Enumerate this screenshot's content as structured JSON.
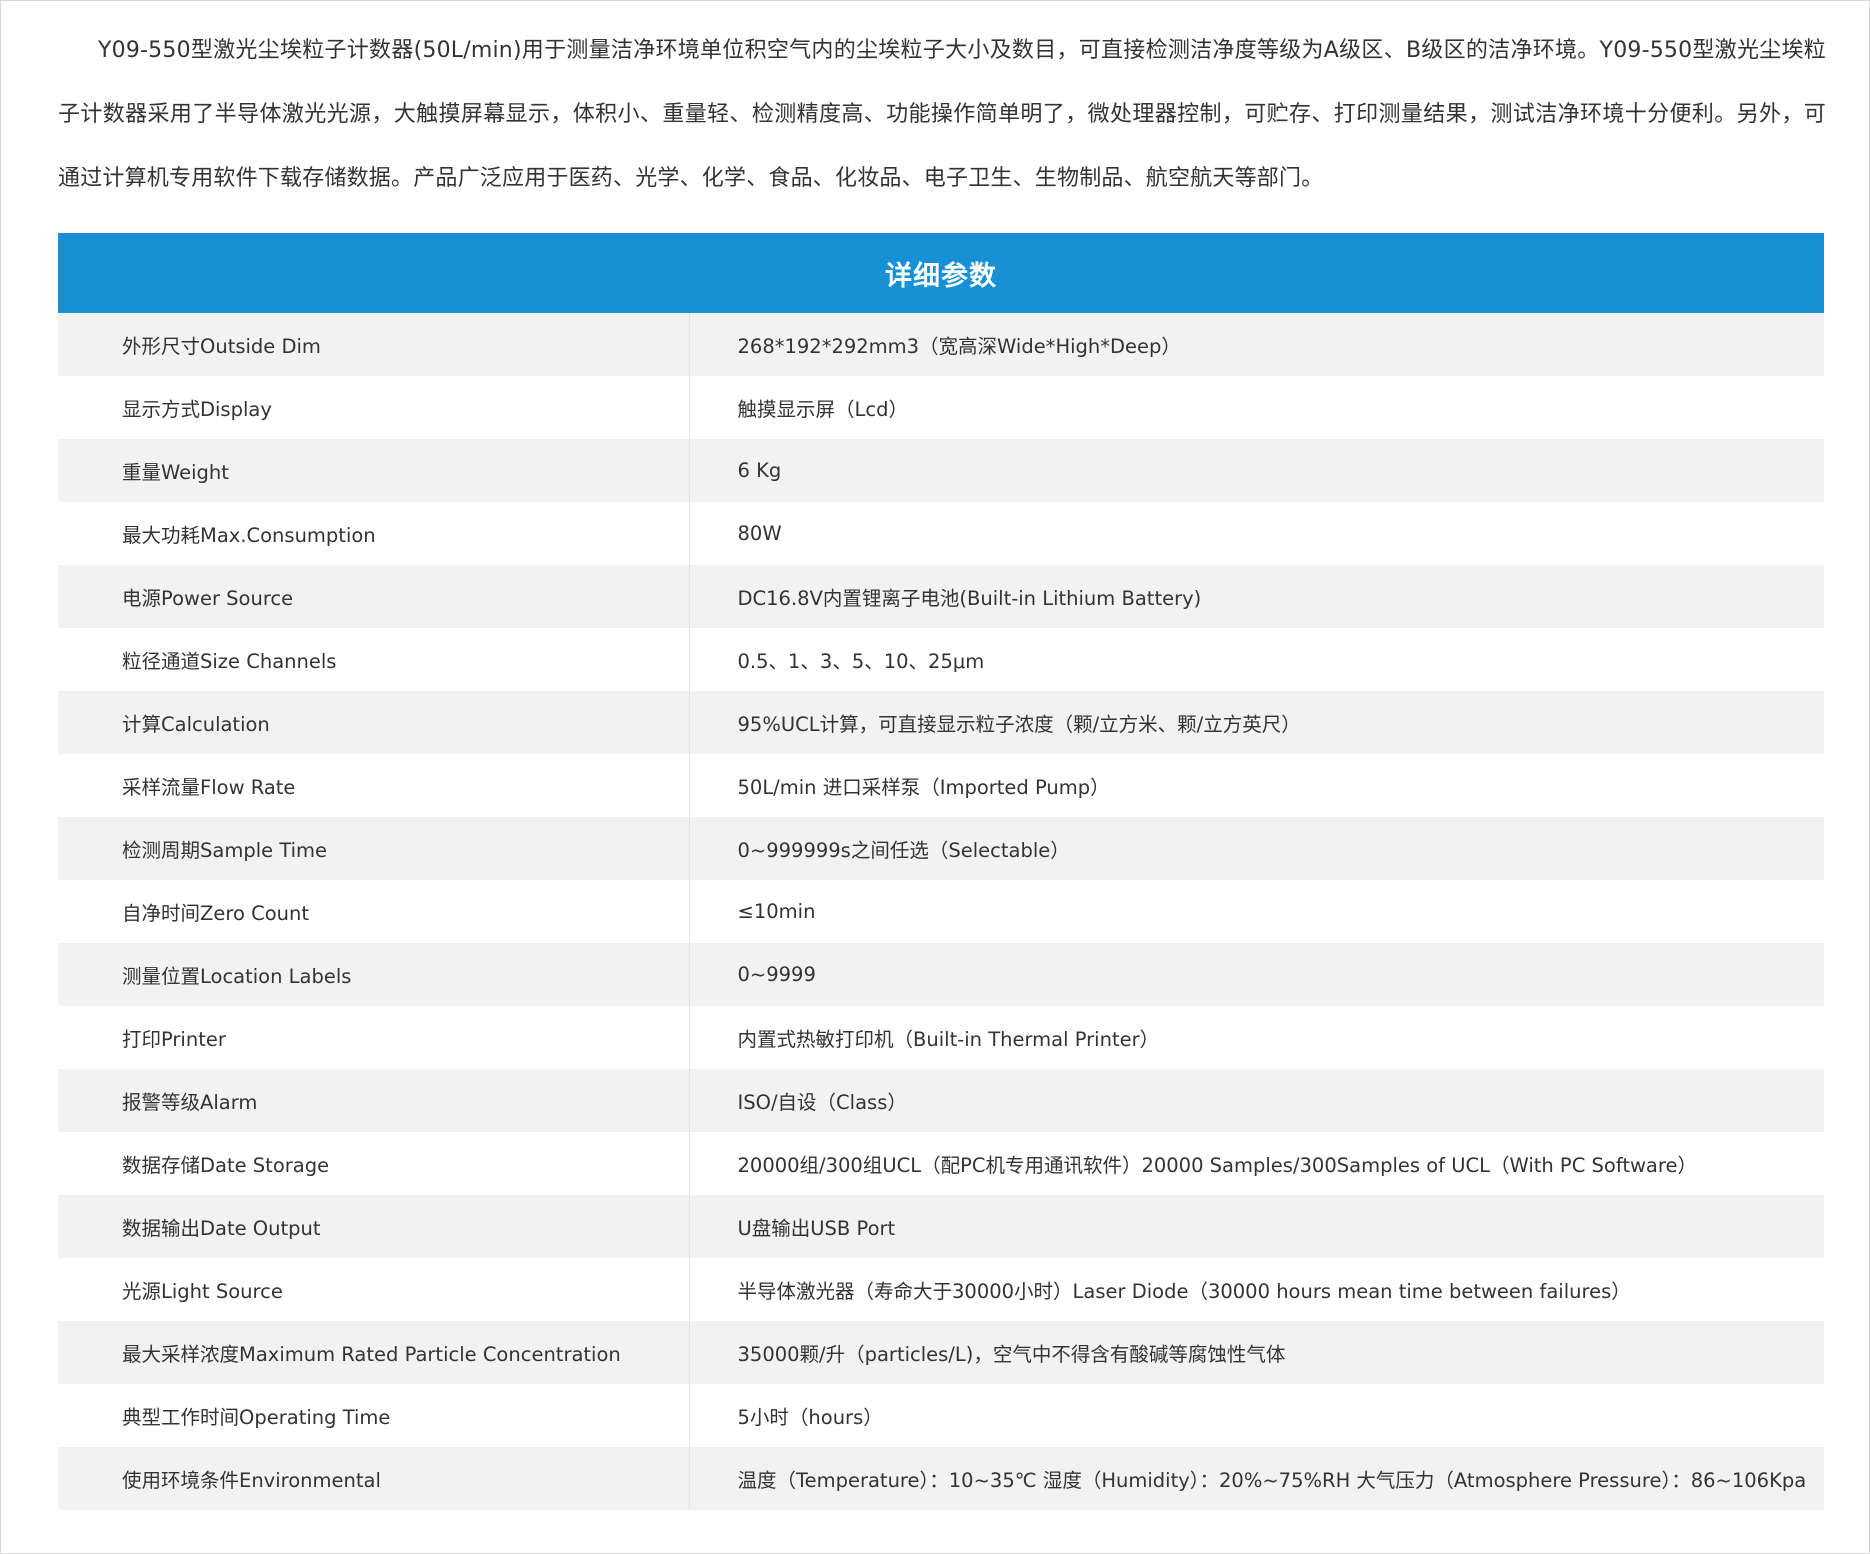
{
  "intro": "Y09-550型激光尘埃粒子计数器(50L/min)用于测量洁净环境单位积空气内的尘埃粒子大小及数目，可直接检测洁净度等级为A级区、B级区的洁净环境。Y09-550型激光尘埃粒子计数器采用了半导体激光光源，大触摸屏幕显示，体积小、重量轻、检测精度高、功能操作简单明了，微处理器控制，可贮存、打印测量结果，测试洁净环境十分便利。另外，可通过计算机专用软件下载存储数据。产品广泛应用于医药、光学、化学、食品、化妆品、电子卫生、生物制品、航空航天等部门。",
  "table": {
    "header": "详细参数",
    "rows": [
      {
        "k": "外形尺寸Outside Dim",
        "v": "268*192*292mm3（宽高深Wide*High*Deep）"
      },
      {
        "k": "显示方式Display",
        "v": "触摸显示屏（Lcd）"
      },
      {
        "k": "重量Weight",
        "v": "6 Kg"
      },
      {
        "k": "最大功耗Max.Consumption",
        "v": "80W"
      },
      {
        "k": "电源Power Source",
        "v": "DC16.8V内置锂离子电池(Built-in Lithium Battery)"
      },
      {
        "k": "粒径通道Size Channels",
        "v": "0.5、1、3、5、10、25μm"
      },
      {
        "k": "计算Calculation",
        "v": "95%UCL计算，可直接显示粒子浓度（颗/立方米、颗/立方英尺）"
      },
      {
        "k": "采样流量Flow Rate",
        "v": "50L/min 进口采样泵（Imported Pump）"
      },
      {
        "k": "检测周期Sample Time",
        "v": "0~999999s之间任选（Selectable）"
      },
      {
        "k": "自净时间Zero Count",
        "v": "≤10min"
      },
      {
        "k": "测量位置Location Labels",
        "v": "0~9999"
      },
      {
        "k": "打印Printer",
        "v": "内置式热敏打印机（Built-in Thermal Printer）"
      },
      {
        "k": "报警等级Alarm",
        "v": "ISO/自设（Class）"
      },
      {
        "k": "数据存储Date Storage",
        "v": "20000组/300组UCL（配PC机专用通讯软件）20000 Samples/300Samples of UCL（With PC Software）"
      },
      {
        "k": "数据输出Date Output",
        "v": "U盘输出USB Port"
      },
      {
        "k": "光源Light Source",
        "v": "半导体激光器（寿命大于30000小时）Laser Diode（30000 hours mean time between failures）"
      },
      {
        "k": "最大采样浓度Maximum Rated Particle Concentration",
        "v": "35000颗/升（particles/L)，空气中不得含有酸碱等腐蚀性气体"
      },
      {
        "k": "典型工作时间Operating Time",
        "v": "5小时（hours）"
      },
      {
        "k": "使用环境条件Environmental",
        "v": "温度（Temperature）：10~35℃  湿度（Humidity）：20%~75%RH  大气压力（Atmosphere Pressure）：86~106Kpa"
      }
    ]
  }
}
